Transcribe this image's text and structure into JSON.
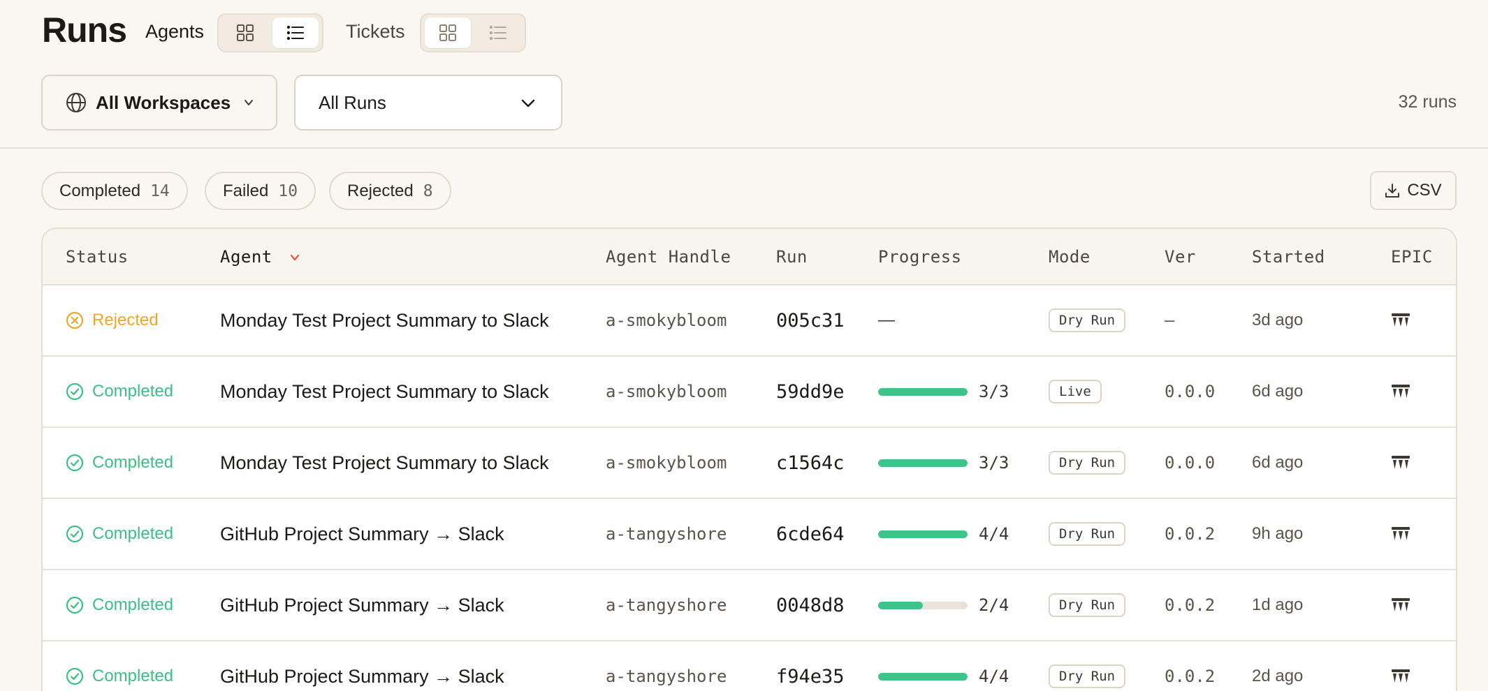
{
  "page_title": "Runs",
  "views": {
    "agents_label": "Agents",
    "tickets_label": "Tickets"
  },
  "filters": {
    "workspace": "All Workspaces",
    "runs": "All Runs",
    "run_count": "32 runs"
  },
  "chips": [
    {
      "label": "Completed",
      "count": "14"
    },
    {
      "label": "Failed",
      "count": "10"
    },
    {
      "label": "Rejected",
      "count": "8"
    }
  ],
  "csv_label": "CSV",
  "columns": [
    "Status",
    "Agent",
    "Agent Handle",
    "Run",
    "Progress",
    "Mode",
    "Ver",
    "Started",
    "EPIC"
  ],
  "rows": [
    {
      "status": "Rejected",
      "status_kind": "rejected",
      "agent": "Monday Test Project Summary to Slack",
      "handle": "a-smokybloom",
      "run": "005c31",
      "progress_text": "—",
      "progress_fraction": null,
      "mode": "Dry Run",
      "ver": "–",
      "started": "3d ago"
    },
    {
      "status": "Completed",
      "status_kind": "completed",
      "agent": "Monday Test Project Summary to Slack",
      "handle": "a-smokybloom",
      "run": "59dd9e",
      "progress_text": "3/3",
      "progress_fraction": 1.0,
      "mode": "Live",
      "ver": "0.0.0",
      "started": "6d ago"
    },
    {
      "status": "Completed",
      "status_kind": "completed",
      "agent": "Monday Test Project Summary to Slack",
      "handle": "a-smokybloom",
      "run": "c1564c",
      "progress_text": "3/3",
      "progress_fraction": 1.0,
      "mode": "Dry Run",
      "ver": "0.0.0",
      "started": "6d ago"
    },
    {
      "status": "Completed",
      "status_kind": "completed",
      "agent": "GitHub Project Summary → Slack",
      "handle": "a-tangyshore",
      "run": "6cde64",
      "progress_text": "4/4",
      "progress_fraction": 1.0,
      "mode": "Dry Run",
      "ver": "0.0.2",
      "started": "9h ago"
    },
    {
      "status": "Completed",
      "status_kind": "completed",
      "agent": "GitHub Project Summary → Slack",
      "handle": "a-tangyshore",
      "run": "0048d8",
      "progress_text": "2/4",
      "progress_fraction": 0.5,
      "mode": "Dry Run",
      "ver": "0.0.2",
      "started": "1d ago"
    },
    {
      "status": "Completed",
      "status_kind": "completed",
      "agent": "GitHub Project Summary → Slack",
      "handle": "a-tangyshore",
      "run": "f94e35",
      "progress_text": "4/4",
      "progress_fraction": 1.0,
      "mode": "Dry Run",
      "ver": "0.0.2",
      "started": "2d ago"
    }
  ],
  "icons": {
    "grid": "grid-view-icon",
    "list": "list-view-icon",
    "globe": "globe-icon",
    "chevron": "chevron-down-icon",
    "download": "download-icon",
    "epic": "epic-icon",
    "completed": "check-circle-icon",
    "rejected": "x-circle-icon"
  },
  "colors": {
    "completed": "#3bbf86",
    "rejected": "#f0a62b",
    "sort_accent": "#e8553a",
    "progress": "#3dc48a"
  }
}
